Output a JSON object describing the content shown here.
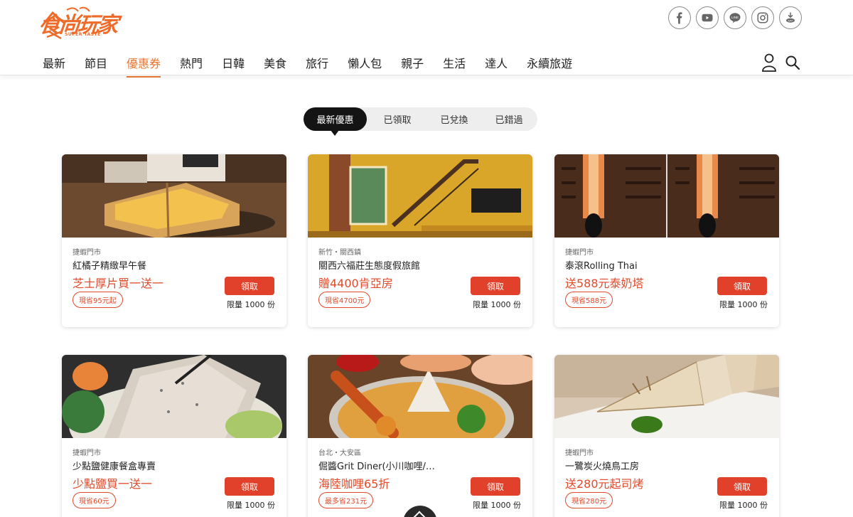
{
  "brand": {
    "logo_text": "食尚玩家",
    "logo_subtext": "SUPER TASTE"
  },
  "social": [
    {
      "icon": "facebook-icon"
    },
    {
      "icon": "youtube-icon"
    },
    {
      "icon": "line-icon",
      "label": "LINE"
    },
    {
      "icon": "instagram-icon"
    },
    {
      "icon": "app-download-icon",
      "label": "APP"
    }
  ],
  "nav": {
    "items": [
      "最新",
      "節目",
      "優惠券",
      "熱門",
      "日韓",
      "美食",
      "旅行",
      "懶人包",
      "親子",
      "生活",
      "達人",
      "永續旅遊"
    ],
    "active_index": 2
  },
  "tabs": {
    "items": [
      "最新優惠",
      "已領取",
      "已兌換",
      "已錯過"
    ],
    "active_index": 0
  },
  "coupons": [
    {
      "location": "捷蝦門市",
      "name": "紅橘子精緻早午餐",
      "deal": "芝士厚片買一送一",
      "saving": "現省95元起",
      "button": "領取",
      "quantity": "限量 1000 份"
    },
    {
      "location": "新竹・關西鎮",
      "name": "關西六福莊生態度假旅館",
      "deal": "贈4400肯亞房",
      "saving": "現省4700元",
      "button": "領取",
      "quantity": "限量 1000 份"
    },
    {
      "location": "捷蝦門市",
      "name": "泰滾Rolling Thai",
      "deal": "送588元泰奶塔",
      "saving": "現省588元",
      "button": "領取",
      "quantity": "限量 1000 份"
    },
    {
      "location": "捷蝦門市",
      "name": "少點鹽健康餐盒專賣",
      "deal": "少點鹽買一送一",
      "saving": "現省60元",
      "button": "領取",
      "quantity": "限量 1000 份"
    },
    {
      "location": "台北・大安區",
      "name": "倔醬Grit Diner(小川咖哩/…",
      "deal": "海陸咖哩65折",
      "saving": "最多省231元",
      "button": "領取",
      "quantity": "限量 1000 份"
    },
    {
      "location": "捷蝦門市",
      "name": "一鷺炭火燒鳥工房",
      "deal": "送280元起司烤",
      "saving": "現省280元",
      "button": "領取",
      "quantity": "限量 1000 份"
    }
  ],
  "colors": {
    "accent": "#e8742e",
    "deal_red": "#e14a2a",
    "tab_active": "#141414"
  }
}
